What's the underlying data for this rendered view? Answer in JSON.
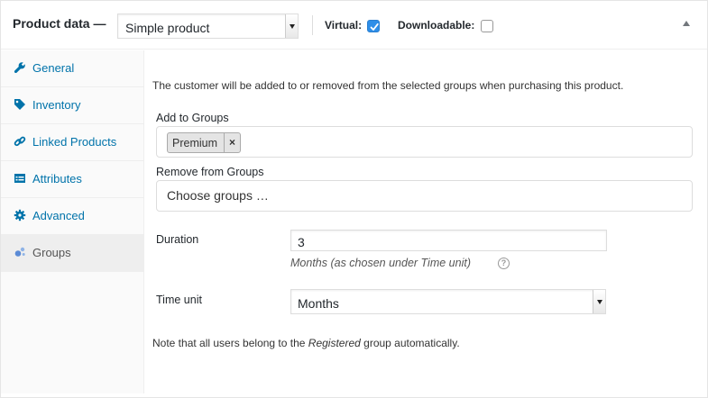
{
  "header": {
    "title": "Product data —",
    "product_type": "Simple product",
    "virtual_label": "Virtual:",
    "virtual_checked": true,
    "downloadable_label": "Downloadable:",
    "downloadable_checked": false
  },
  "sidebar": {
    "items": [
      {
        "label": "General",
        "icon": "wrench-icon"
      },
      {
        "label": "Inventory",
        "icon": "tag-icon"
      },
      {
        "label": "Linked Products",
        "icon": "link-icon"
      },
      {
        "label": "Attributes",
        "icon": "table-icon"
      },
      {
        "label": "Advanced",
        "icon": "gear-icon"
      },
      {
        "label": "Groups",
        "icon": "groups-icon",
        "active": true
      }
    ]
  },
  "groups": {
    "description": "The customer will be added to or removed from the selected groups when purchasing this product.",
    "add_label": "Add to Groups",
    "add_selected": [
      "Premium"
    ],
    "remove_label": "Remove from Groups",
    "remove_placeholder": "Choose groups …",
    "duration_label": "Duration",
    "duration_value": "3",
    "duration_hint": "Months (as chosen under Time unit)",
    "time_unit_label": "Time unit",
    "time_unit_value": "Months",
    "note_before": "Note that all users belong to the ",
    "note_em": "Registered",
    "note_after": " group automatically."
  },
  "colors": {
    "link": "#0073aa",
    "checkbox_checked": "#2e8ee8"
  }
}
